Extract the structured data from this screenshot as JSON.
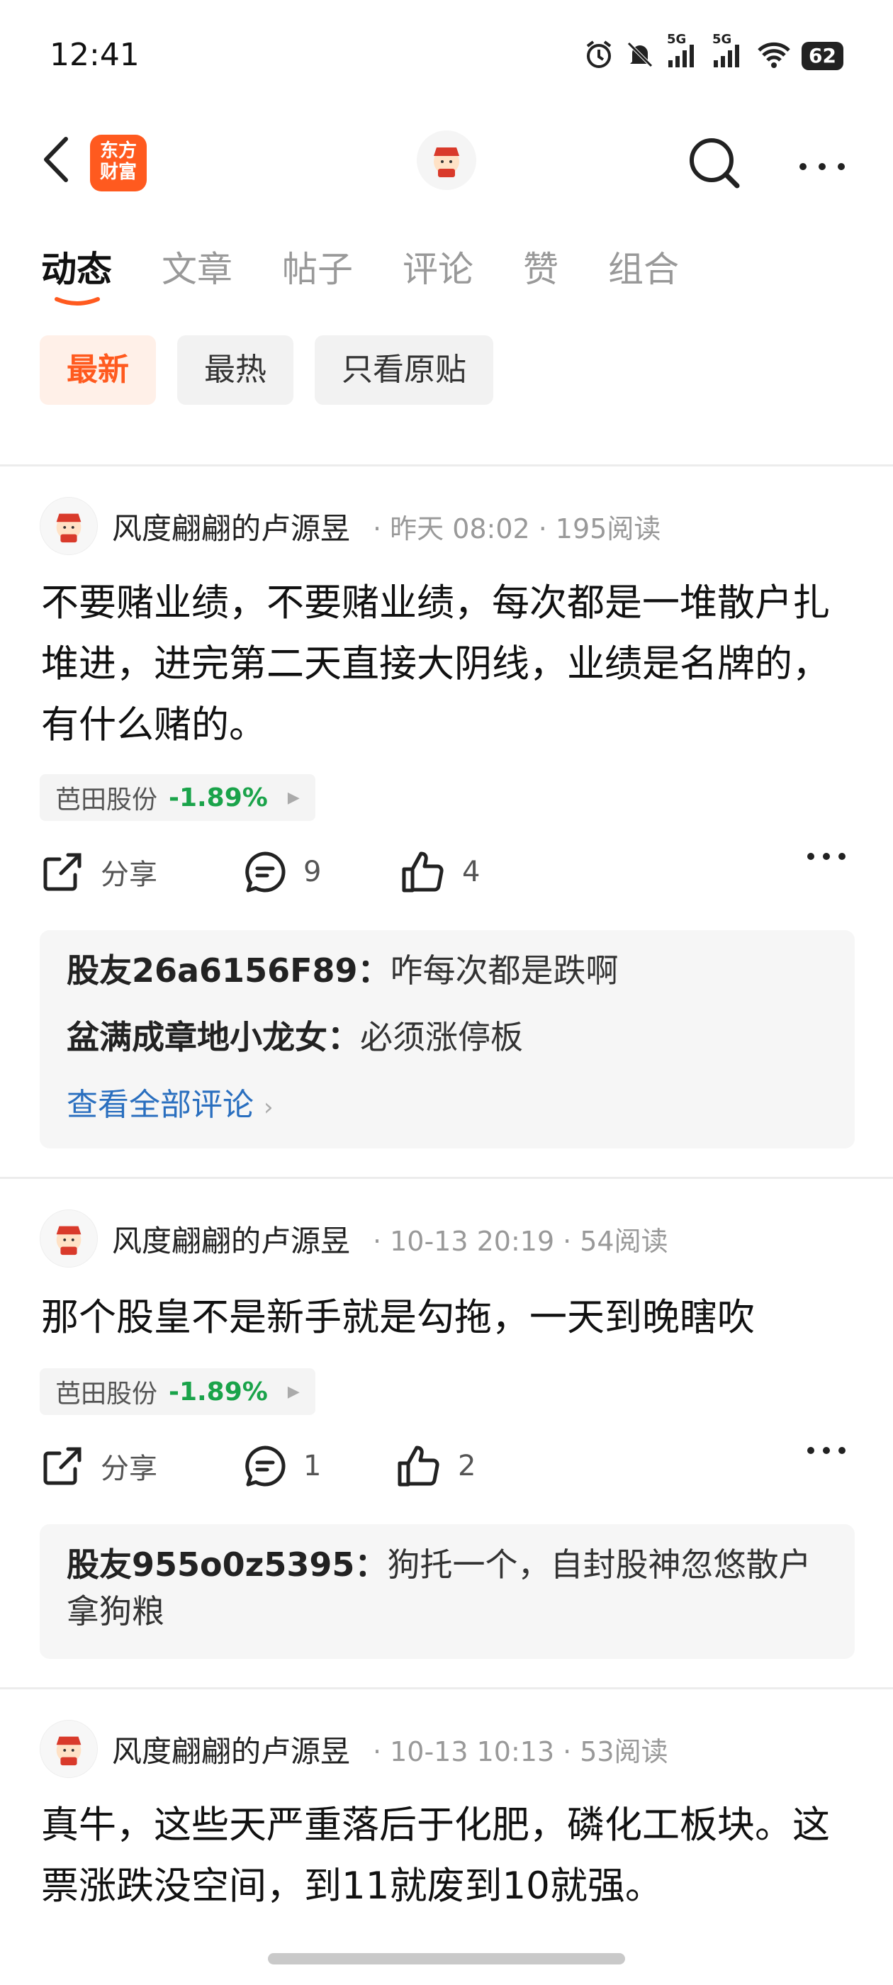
{
  "status": {
    "time": "12:41",
    "battery": "62",
    "network1": "5G",
    "network2": "5G"
  },
  "header": {
    "logo_line1": "东方",
    "logo_line2": "财富"
  },
  "tabs": [
    {
      "label": "动态",
      "active": true
    },
    {
      "label": "文章"
    },
    {
      "label": "帖子"
    },
    {
      "label": "评论"
    },
    {
      "label": "赞"
    },
    {
      "label": "组合"
    }
  ],
  "filters": [
    {
      "label": "最新",
      "active": true
    },
    {
      "label": "最热"
    },
    {
      "label": "只看原贴"
    }
  ],
  "colors": {
    "accent": "#ff5a1f",
    "stock_down": "#1aa34a",
    "link": "#2a6fbf"
  },
  "posts": [
    {
      "author": "风度翩翩的卢源昱",
      "time": "昨天 08:02",
      "reads": "195阅读",
      "text": "不要赌业绩，不要赌业绩，每次都是一堆散户扎堆进，进完第二天直接大阴线，业绩是名牌的，有什么赌的。",
      "stock_name": "芭田股份",
      "stock_change": "-1.89%",
      "share_label": "分享",
      "comment_count": "9",
      "like_count": "4",
      "comments": [
        {
          "user": "股友26a6156F89：",
          "text": "咋每次都是跌啊"
        },
        {
          "user": "盆满成章地小龙女：",
          "text": "必须涨停板"
        }
      ],
      "view_all": "查看全部评论"
    },
    {
      "author": "风度翩翩的卢源昱",
      "time": "10-13 20:19",
      "reads": "54阅读",
      "text": "那个股皇不是新手就是勾拖，一天到晚瞎吹",
      "stock_name": "芭田股份",
      "stock_change": "-1.89%",
      "share_label": "分享",
      "comment_count": "1",
      "like_count": "2",
      "comments": [
        {
          "user": "股友955o0z5395：",
          "text": "狗托一个，自封股神忽悠散户拿狗粮"
        }
      ]
    },
    {
      "author": "风度翩翩的卢源昱",
      "time": "10-13 10:13",
      "reads": "53阅读",
      "text": "真牛，这些天严重落后于化肥，磷化工板块。这票涨跌没空间，到11就废到10就强。"
    }
  ]
}
